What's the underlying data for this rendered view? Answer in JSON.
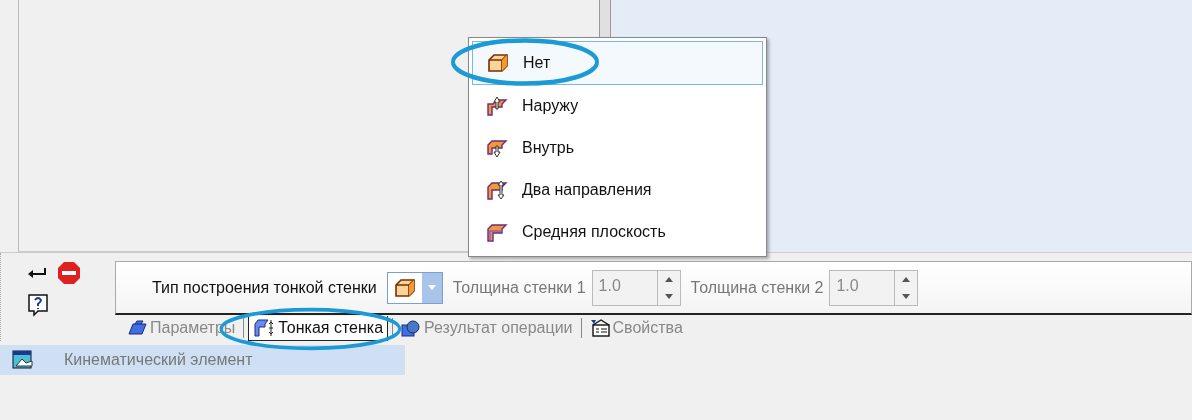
{
  "menu": {
    "items": [
      {
        "label": "Нет",
        "kind": "none",
        "selected": true,
        "circled": true
      },
      {
        "label": "Наружу",
        "kind": "out",
        "selected": false,
        "circled": false
      },
      {
        "label": "Внутрь",
        "kind": "in",
        "selected": false,
        "circled": false
      },
      {
        "label": "Два направления",
        "kind": "both",
        "selected": false,
        "circled": false
      },
      {
        "label": "Средняя плоскость",
        "kind": "mid",
        "selected": false,
        "circled": false
      }
    ]
  },
  "toolbar": {
    "type_label": "Тип построения тонкой стенки",
    "type_combo": {
      "kind": "none"
    },
    "fields": [
      {
        "label": "Толщина стенки 1",
        "value": "1.0"
      },
      {
        "label": "Толщина стенки 2",
        "value": "1.0"
      }
    ]
  },
  "tabs": [
    {
      "label": "Параметры",
      "kind": "params",
      "selected": false,
      "circled": false
    },
    {
      "label": "Тонкая стенка",
      "kind": "thin",
      "selected": true,
      "circled": true
    },
    {
      "label": "Результат операции",
      "kind": "result",
      "selected": false,
      "circled": false
    },
    {
      "label": "Свойства",
      "kind": "props",
      "selected": false,
      "circled": false
    }
  ],
  "tree": {
    "item": {
      "label": "Кинематический элемент",
      "selected": true
    }
  }
}
